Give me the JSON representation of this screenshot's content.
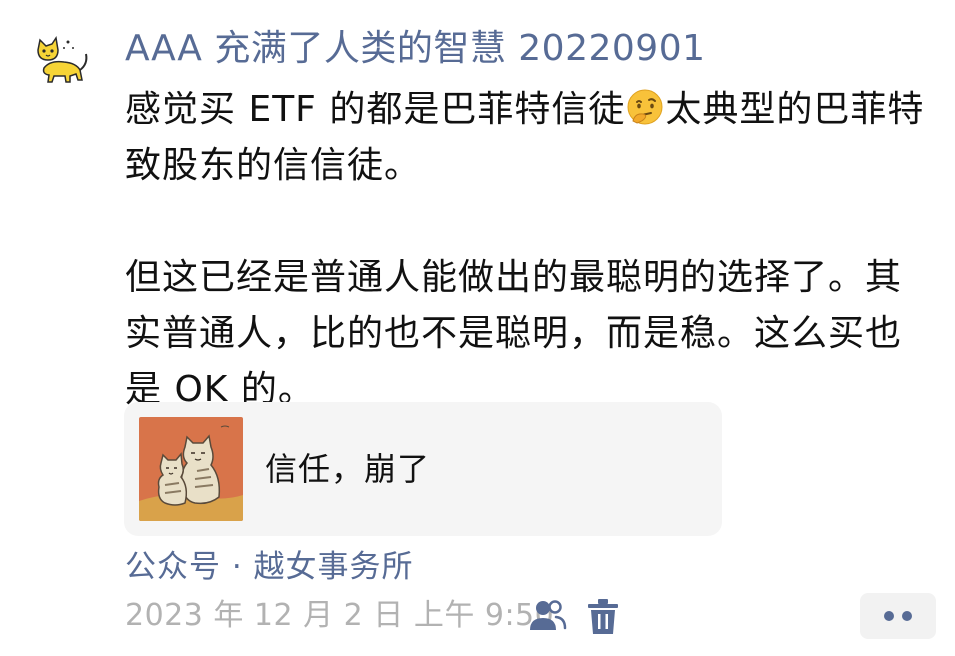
{
  "post": {
    "author": "AAA 充满了人类的智慧 20220901",
    "text_line1_part1": "感觉买 ETF 的都是巴菲特信徒",
    "emoji": "thinking-face-emoji",
    "text_line1_part2": "太典型的巴菲特",
    "text_line2": "致股东的信信徒。",
    "text_line3": "但这已经是普通人能做出的最聪明的选择了。其",
    "text_line4": "实普通人，比的也不是聪明，而是稳。这么买也",
    "text_line5": "是 OK 的。"
  },
  "share_card": {
    "thumbnail": "two-tabby-cats-illustration",
    "title": "信任，崩了"
  },
  "source": "公众号 · 越女事务所",
  "meta": {
    "timestamp": "2023 年 12 月 2 日  上午 9:50",
    "visibility_icon": "friends-visibility-icon",
    "delete_icon": "trash-icon",
    "more_icon": "more-dots-icon"
  },
  "colors": {
    "link_blue": "#576b95",
    "timestamp_gray": "#b2b2b2",
    "card_bg": "#f5f5f5",
    "thumb_bg": "#d8744a"
  }
}
